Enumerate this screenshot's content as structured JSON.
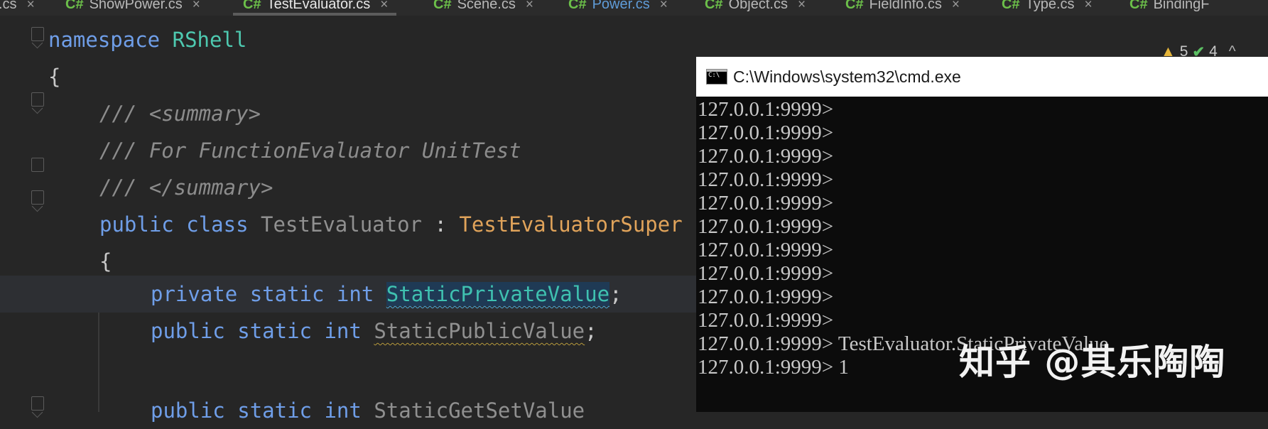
{
  "tabs": [
    {
      "lang": "C#",
      "name": ".cs",
      "state": "normal"
    },
    {
      "lang": "C#",
      "name": "ShowPower.cs",
      "state": "normal"
    },
    {
      "lang": "C#",
      "name": "TestEvaluator.cs",
      "state": "active"
    },
    {
      "lang": "C#",
      "name": "Scene.cs",
      "state": "normal"
    },
    {
      "lang": "C#",
      "name": "Power.cs",
      "state": "blue"
    },
    {
      "lang": "C#",
      "name": "Object.cs",
      "state": "normal"
    },
    {
      "lang": "C#",
      "name": "FieldInfo.cs",
      "state": "normal"
    },
    {
      "lang": "C#",
      "name": "Type.cs",
      "state": "normal"
    },
    {
      "lang": "C#",
      "name": "BindingF",
      "state": "normal"
    }
  ],
  "tab_close_glyph": "×",
  "inspection": {
    "warnings": "5",
    "ok": "4",
    "chevron": "^"
  },
  "code": {
    "l1_kw": "namespace",
    "l1_ns": "RShell",
    "l2": "{",
    "l3": "/// <summary>",
    "l4": "/// For FunctionEvaluator UnitTest",
    "l5": "/// </summary>",
    "l6_kw1": "public",
    "l6_kw2": "class",
    "l6_cls": "TestEvaluator",
    "l6_sep": " : ",
    "l6_sup": "TestEvaluatorSuper",
    "l7": "{",
    "l8_kw1": "private",
    "l8_kw2": "static",
    "l8_kw3": "int",
    "l8_id": "StaticPrivateValue",
    "l8_end": ";",
    "l9_kw1": "public",
    "l9_kw2": "static",
    "l9_kw3": "int",
    "l9_id": "StaticPublicValue",
    "l9_end": ";",
    "l11_kw1": "public",
    "l11_kw2": "static",
    "l11_kw3": "int",
    "l11_id": "StaticGetSetValue"
  },
  "cmd": {
    "title": "C:\\Windows\\system32\\cmd.exe",
    "lines": [
      "127.0.0.1:9999>",
      "127.0.0.1:9999>",
      "127.0.0.1:9999>",
      "127.0.0.1:9999>",
      "127.0.0.1:9999>",
      "127.0.0.1:9999>",
      "127.0.0.1:9999>",
      "127.0.0.1:9999>",
      "127.0.0.1:9999>",
      "127.0.0.1:9999>",
      "127.0.0.1:9999> TestEvaluator.StaticPrivateValue",
      "127.0.0.1:9999> 1"
    ]
  },
  "watermark": "知乎 @其乐陶陶",
  "colors": {
    "editor_bg": "#262626",
    "keyword": "#6f9ee8",
    "namespace": "#4ec9b0",
    "supertype": "#e0a35a",
    "cmd_bg": "#0c0c0c"
  }
}
